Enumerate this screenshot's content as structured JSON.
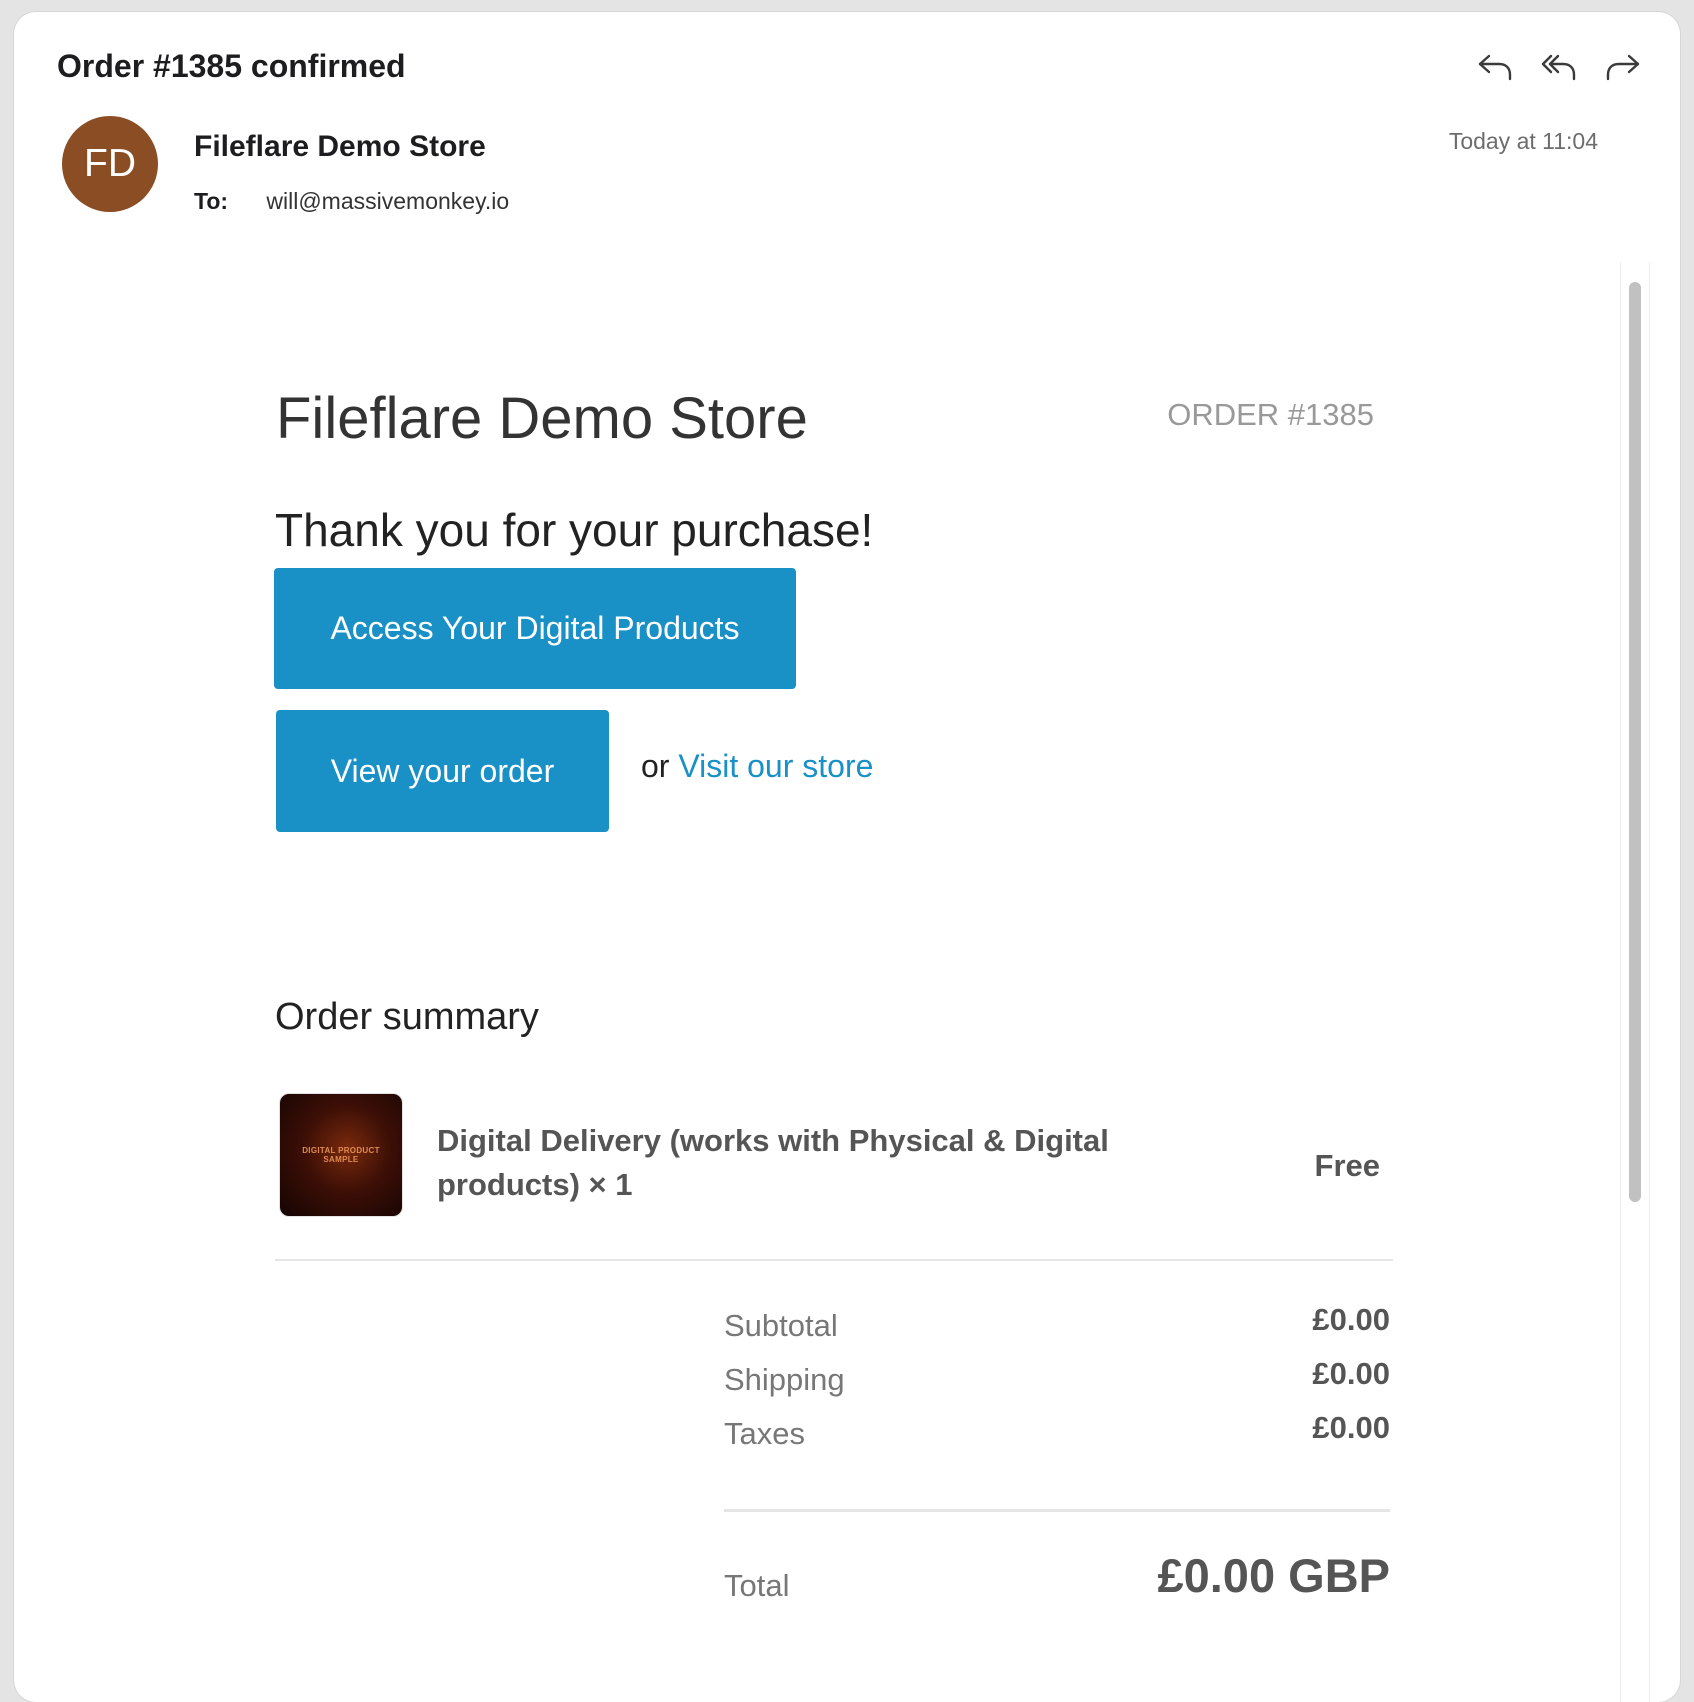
{
  "mail": {
    "subject": "Order #1385 confirmed",
    "sender_initials": "FD",
    "sender_name": "Fileflare Demo Store",
    "to_label": "To:",
    "to_address": "will@massivemonkey.io",
    "date": "Today at 11:04",
    "avatar_color": "#8b4d24",
    "toolbar_icons": [
      "reply-icon",
      "reply-all-icon",
      "forward-icon"
    ]
  },
  "email": {
    "store_title": "Fileflare Demo Store",
    "order_number": "ORDER #1385",
    "thanks": "Thank you for your purchase!",
    "access_button": "Access Your Digital Products",
    "view_order_button": "View your order",
    "or_text": "or",
    "visit_store_link": "Visit our store",
    "summary_title": "Order summary",
    "accent_color": "#1990c6",
    "item": {
      "thumb_text_line1": "DIGITAL PRODUCT",
      "thumb_text_line2": "SAMPLE",
      "name": "Digital Delivery (works with Physical & Digital products) × 1",
      "price": "Free"
    },
    "totals": {
      "subtotal_label": "Subtotal",
      "subtotal_value": "£0.00",
      "shipping_label": "Shipping",
      "shipping_value": "£0.00",
      "taxes_label": "Taxes",
      "taxes_value": "£0.00",
      "total_label": "Total",
      "total_value": "£0.00 GBP"
    }
  }
}
